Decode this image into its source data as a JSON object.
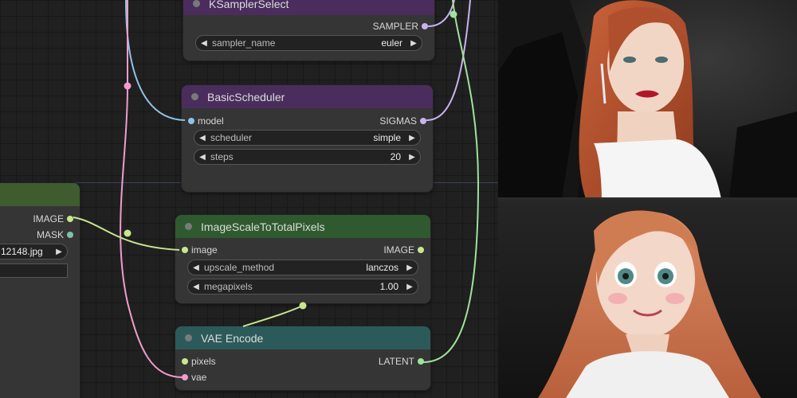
{
  "nodes": {
    "ksampler_select": {
      "title": "KSamplerSelect",
      "output": "SAMPLER",
      "widgets": [
        {
          "label": "sampler_name",
          "value": "euler"
        }
      ]
    },
    "basic_scheduler": {
      "title": "BasicScheduler",
      "input": "model",
      "output": "SIGMAS",
      "widgets": [
        {
          "label": "scheduler",
          "value": "simple"
        },
        {
          "label": "steps",
          "value": "20"
        }
      ]
    },
    "load_image": {
      "outputs": [
        "IMAGE",
        "MASK"
      ],
      "filename": "12148.jpg"
    },
    "image_scale": {
      "title": "ImageScaleToTotalPixels",
      "input": "image",
      "output": "IMAGE",
      "widgets": [
        {
          "label": "upscale_method",
          "value": "lanczos"
        },
        {
          "label": "megapixels",
          "value": "1.00"
        }
      ]
    },
    "vae_encode": {
      "title": "VAE Encode",
      "inputs": [
        "pixels",
        "vae"
      ],
      "output": "LATENT"
    }
  },
  "colors": {
    "header_purple": "#4a2d5d",
    "header_green": "#2f5a2f",
    "header_load_green": "#3e5c2e",
    "header_teal": "#2c5a5a",
    "pin_model": "#8fc3e6",
    "pin_sampler": "#c9b2f0",
    "pin_image": "#c8e68e",
    "pin_mask": "#7fc2a6",
    "pin_latent": "#9fe39a",
    "pin_vae": "#f19ccc"
  },
  "icons": {
    "left_arrow": "◀",
    "right_arrow": "▶"
  }
}
